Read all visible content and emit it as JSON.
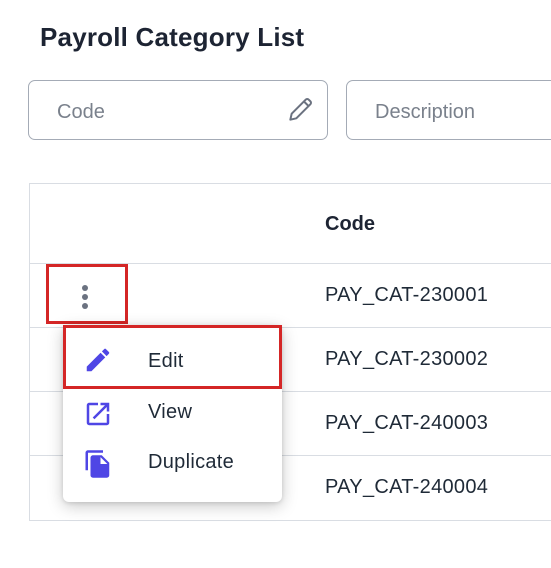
{
  "page": {
    "title": "Payroll Category List"
  },
  "filters": {
    "code": {
      "placeholder": "Code",
      "value": ""
    },
    "description": {
      "placeholder": "Description",
      "value": ""
    }
  },
  "table": {
    "columns": {
      "code": "Code"
    },
    "rows": [
      {
        "code": "PAY_CAT-230001"
      },
      {
        "code": "PAY_CAT-230002"
      },
      {
        "code": "PAY_CAT-240003"
      },
      {
        "code": "PAY_CAT-240004"
      }
    ]
  },
  "row_menu": {
    "items": [
      {
        "label": "Edit",
        "icon": "pencil-icon"
      },
      {
        "label": "View",
        "icon": "open-in-new-icon"
      },
      {
        "label": "Duplicate",
        "icon": "copy-icon"
      }
    ]
  },
  "colors": {
    "accent": "#4f46e5",
    "highlight": "#d42626"
  }
}
